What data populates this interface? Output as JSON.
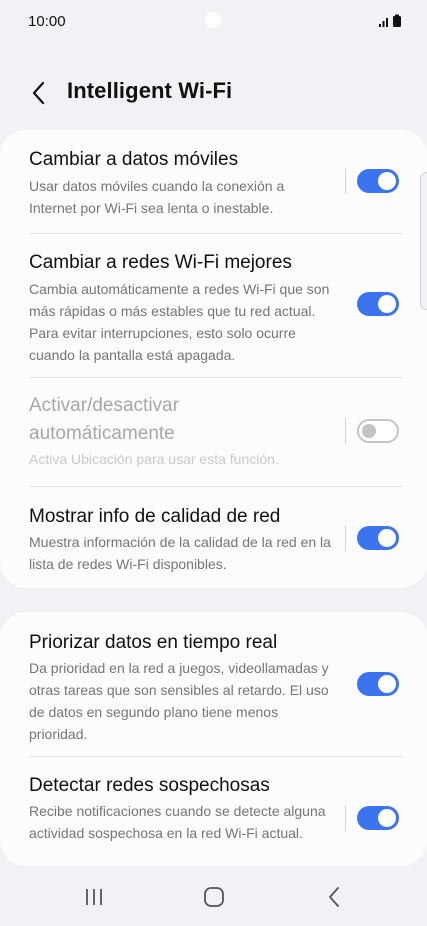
{
  "status_bar": {
    "time": "10:00"
  },
  "header": {
    "title": "Intelligent Wi-Fi"
  },
  "sections": [
    {
      "items": [
        {
          "title": "Cambiar a datos móviles",
          "description": "Usar datos móviles cuando la conexión a Internet por Wi-Fi sea lenta o inestable.",
          "enabled": true
        },
        {
          "title": "Cambiar a redes Wi-Fi mejores",
          "description": "Cambia automáticamente a redes Wi-Fi que son más rápidas o más estables que tu red actual. Para evitar interrupciones, esto solo ocurre cuando la pantalla está apagada.",
          "enabled": true
        },
        {
          "title": "Activar/desactivar automáticamente",
          "description": "Activa Ubicación para usar esta función.",
          "enabled": false
        },
        {
          "title": "Mostrar info de calidad de red",
          "description": "Muestra información de la calidad de la red en la lista de redes Wi-Fi disponibles.",
          "enabled": true
        }
      ]
    },
    {
      "items": [
        {
          "title": "Priorizar datos en tiempo real",
          "description": "Da prioridad en la red a juegos, videollamadas y otras tareas que son sensibles al retardo. El uso de datos en segundo plano tiene menos prioridad.",
          "enabled": true
        },
        {
          "title": "Detectar redes sospechosas",
          "description": "Recibe notificaciones cuando se detecte alguna actividad sospechosa en la red Wi-Fi actual.",
          "enabled": true
        }
      ]
    }
  ],
  "colors": {
    "accent": "#3c74f0",
    "background": "#f2f2f6",
    "card": "#fcfcfd"
  },
  "icons": {
    "back": "chevron-left-icon",
    "signal": "signal-bars-icon",
    "battery": "battery-icon",
    "nav_recents": "recent-apps-icon",
    "nav_home": "home-icon",
    "nav_back": "back-icon"
  }
}
